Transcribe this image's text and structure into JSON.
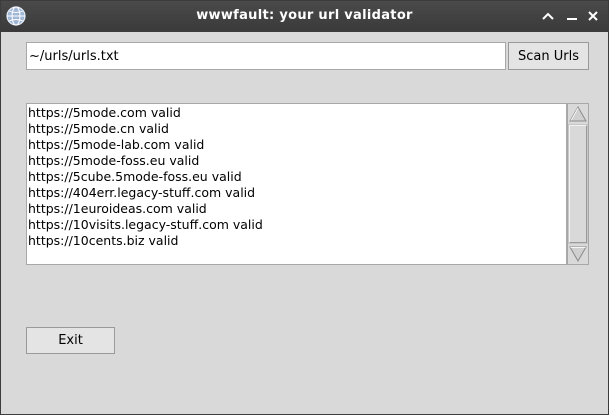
{
  "window": {
    "title": "wwwfault: your url validator",
    "icons": {
      "app": "app-globe-icon",
      "maximize": "chevron-up-icon",
      "minimize": "minimize-icon",
      "close": "close-icon"
    }
  },
  "scan": {
    "path_value": "~/urls/urls.txt",
    "button_label": "Scan Urls"
  },
  "results": {
    "items": [
      "https://5mode.com valid",
      "https://5mode.cn valid",
      "https://5mode-lab.com valid",
      "https://5mode-foss.eu valid",
      "https://5cube.5mode-foss.eu valid",
      "https://404err.legacy-stuff.com valid",
      "https://1euroideas.com valid",
      "https://10visits.legacy-stuff.com valid",
      "https://10cents.biz valid"
    ]
  },
  "exit": {
    "button_label": "Exit"
  },
  "colors": {
    "titlebar": "#3a3a3a",
    "background": "#d9d9d9",
    "list_background": "#ffffff"
  }
}
